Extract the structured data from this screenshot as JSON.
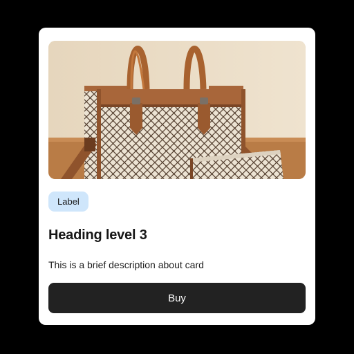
{
  "card": {
    "image_alt": "Brown and cream monogram handbag set",
    "badge_label": "Label",
    "heading": "Heading level 3",
    "description": "This is a brief description about card",
    "button_label": "Buy"
  },
  "colors": {
    "page_background": "#000000",
    "card_background": "#ffffff",
    "badge_background": "#cfe6fb",
    "button_background": "#222222",
    "button_text": "#ffffff"
  },
  "icons": {
    "product_image": "handbag-photo"
  }
}
